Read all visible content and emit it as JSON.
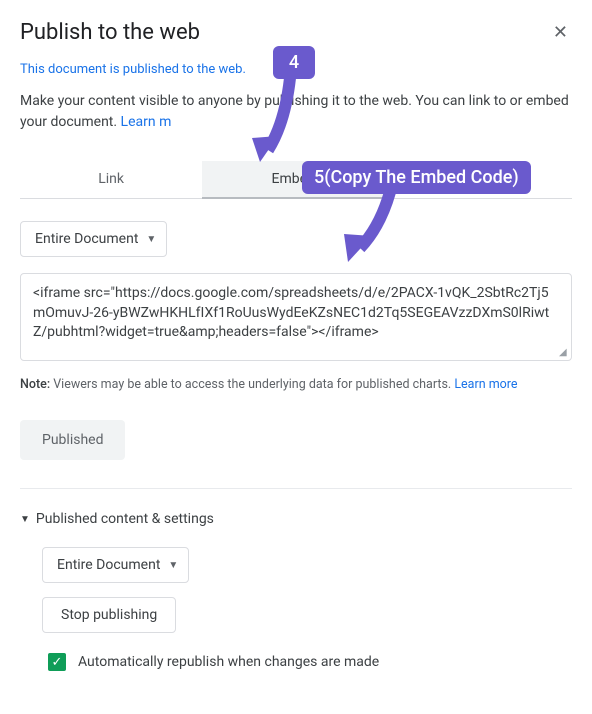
{
  "dialog": {
    "title": "Publish to the web",
    "status": "This document is published to the web.",
    "description": "Make your content visible to anyone by publishing it to the web. You can link to or embed your document. ",
    "learn_more": "Learn m"
  },
  "tabs": {
    "link": "Link",
    "embed": "Embed"
  },
  "content": {
    "dropdown_label": "Entire Document",
    "embed_code": "<iframe src=\"https://docs.google.com/spreadsheets/d/e/2PACX-1vQK_2SbtRc2Tj5mOmuvJ-26-yBWZwHKHLfIXf1RoUusWydEeKZsNEC1d2Tq5SEGEAVzzDXmS0lRiwtZ/pubhtml?widget=true&amp;headers=false\"></iframe>",
    "note_label": "Note:",
    "note_text": " Viewers may be able to access the underlying data for published charts. ",
    "note_link": "Learn more",
    "published_label": "Published"
  },
  "settings": {
    "section_title": "Published content & settings",
    "dropdown_label": "Entire Document",
    "stop_label": "Stop publishing",
    "checkbox_label": "Automatically republish when changes are made"
  },
  "annotations": {
    "step4": "4",
    "step5": "5(Copy The Embed Code)"
  }
}
